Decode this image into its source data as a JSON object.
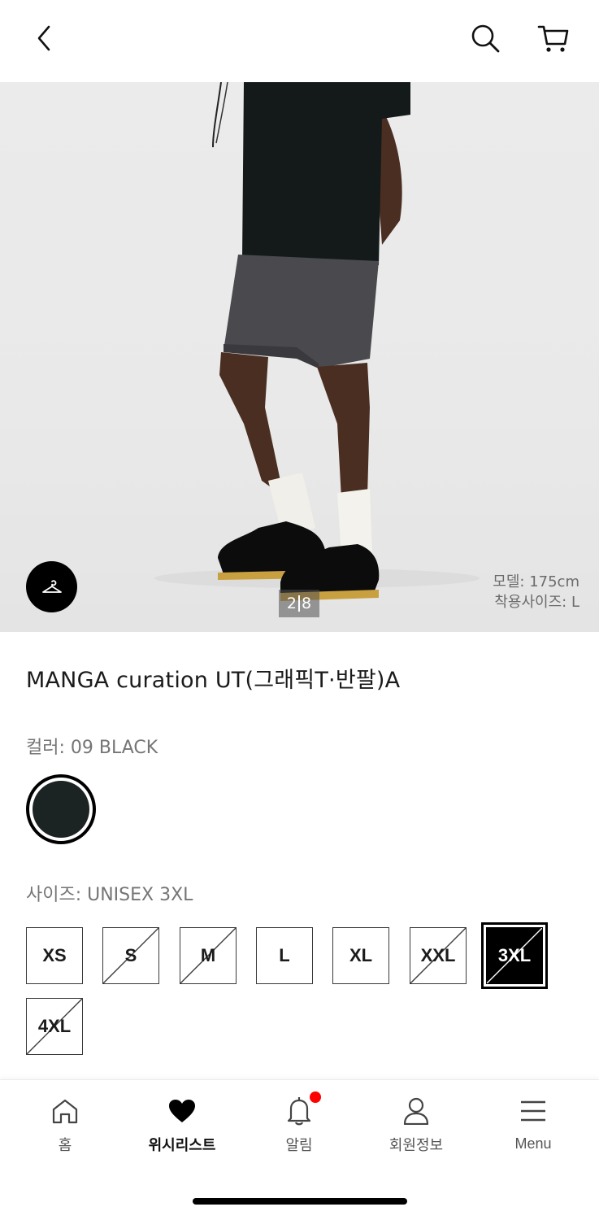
{
  "header": {
    "back_icon": "chevron-left-icon",
    "search_icon": "search-icon",
    "cart_icon": "cart-icon"
  },
  "gallery": {
    "current_page": "2",
    "total_pages": "8",
    "model_height": "모델: 175cm",
    "model_size": "착용사이즈: L",
    "fab_icon": "hanger-icon"
  },
  "product": {
    "title": "MANGA curation UT(그래픽T·반팔)A",
    "color_label": "컬러: 09 BLACK",
    "color_hex": "#1c2323",
    "size_label": "사이즈: UNISEX 3XL",
    "sizes": [
      {
        "label": "XS",
        "available": true,
        "selected": false
      },
      {
        "label": "S",
        "available": false,
        "selected": false
      },
      {
        "label": "M",
        "available": false,
        "selected": false
      },
      {
        "label": "L",
        "available": true,
        "selected": false
      },
      {
        "label": "XL",
        "available": true,
        "selected": false
      },
      {
        "label": "XXL",
        "available": false,
        "selected": false
      },
      {
        "label": "3XL",
        "available": false,
        "selected": true
      },
      {
        "label": "4XL",
        "available": false,
        "selected": false
      }
    ]
  },
  "nav": {
    "items": [
      {
        "label": "홈",
        "icon": "home-icon"
      },
      {
        "label": "위시리스트",
        "icon": "heart-icon"
      },
      {
        "label": "알림",
        "icon": "bell-icon"
      },
      {
        "label": "회원정보",
        "icon": "user-icon"
      },
      {
        "label": "Menu",
        "icon": "menu-icon"
      }
    ],
    "badge_color": "#ff0000"
  }
}
